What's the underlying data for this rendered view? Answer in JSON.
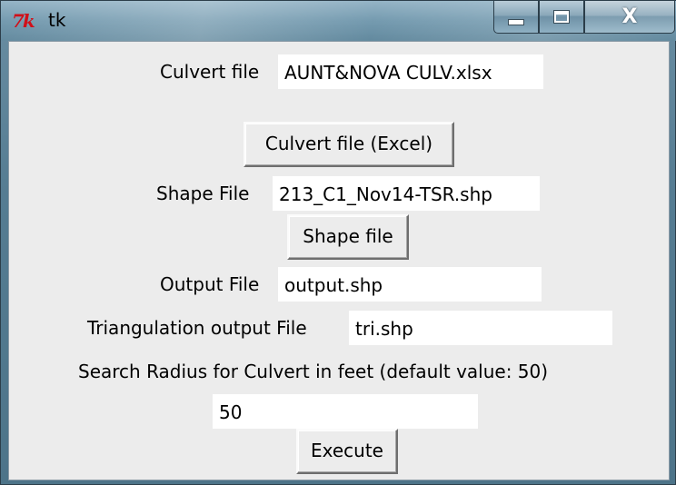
{
  "window": {
    "title": "tk",
    "logo_text": "7k",
    "controls": {
      "minimize_icon": "minimize-icon",
      "maximize_icon": "maximize-icon",
      "close_label": "X"
    }
  },
  "form": {
    "culvert_label": "Culvert file",
    "culvert_value": "AUNT&NOVA CULV.xlsx",
    "culvert_button": "Culvert file (Excel)",
    "shape_label": "Shape File",
    "shape_value": "213_C1_Nov14-TSR.shp",
    "shape_button": "Shape file",
    "output_label": "Output File",
    "output_value": "output.shp",
    "tri_label": "Triangulation output File",
    "tri_value": "tri.shp",
    "radius_label": "Search Radius for Culvert in feet (default value: 50)",
    "radius_value": "50",
    "execute_button": "Execute"
  }
}
